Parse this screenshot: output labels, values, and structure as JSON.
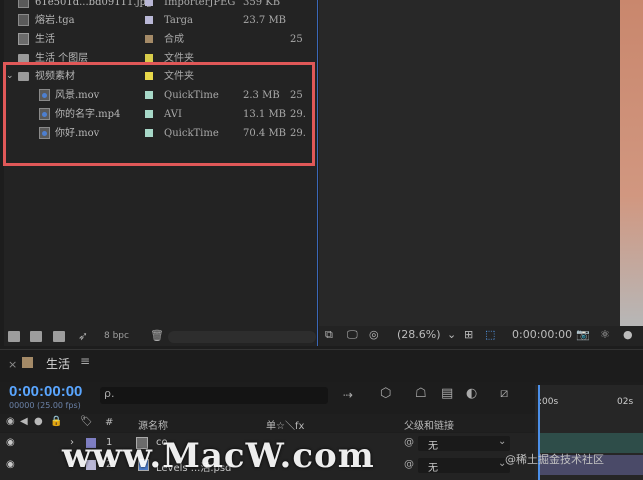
{
  "project_panel": {
    "rows": [
      {
        "name": "61e501d...bd09111.jpg",
        "type": "ImporterJPEG",
        "size": "359 KB",
        "fps": "",
        "tag_color": "#b9b7d6",
        "kind": "file"
      },
      {
        "name": "熔岩.tga",
        "type": "Targa",
        "size": "23.7 MB",
        "fps": "",
        "tag_color": "#b9b7d6",
        "kind": "file"
      },
      {
        "name": "生活",
        "type": "合成",
        "size": "",
        "fps": "25",
        "tag_color": "#a48a67",
        "kind": "comp"
      },
      {
        "name": "生活 个图层",
        "type": "文件夹",
        "size": "",
        "fps": "",
        "tag_color": "#d8cc4a",
        "kind": "folder"
      },
      {
        "name": "视频素材",
        "type": "文件夹",
        "size": "",
        "fps": "",
        "tag_color": "#e8d84a",
        "kind": "folder"
      },
      {
        "name": "风景.mov",
        "type": "QuickTime",
        "size": "2.3 MB",
        "fps": "25",
        "tag_color": "#a7d8c8",
        "kind": "file"
      },
      {
        "name": "你的名字.mp4",
        "type": "AVI",
        "size": "13.1 MB",
        "fps": "29.",
        "tag_color": "#a7d8c8",
        "kind": "file"
      },
      {
        "name": "你好.mov",
        "type": "QuickTime",
        "size": "70.4 MB",
        "fps": "29.",
        "tag_color": "#a7d8c8",
        "kind": "file"
      }
    ],
    "footer": {
      "bpc": "8 bpc"
    }
  },
  "viewer_toolbar": {
    "zoom": "(28.6%)",
    "timecode": "0:00:00:00"
  },
  "timeline": {
    "tab_close": "×",
    "tab_name": "生活",
    "menu_icon": "≡",
    "current_time": "0:00:00:00",
    "fps_label": "00000 (25.00 fps)",
    "search_placeholder": "ρ.",
    "columns": {
      "hash": "#",
      "source_name": "源名称",
      "switches": "单☆＼fx",
      "parent": "父级和链接"
    },
    "rows": [
      {
        "index": "1",
        "name": "co",
        "parent": "无",
        "label_color": "#7e7ec2"
      },
      {
        "index": "2",
        "name": "Levels ...活.psd",
        "parent": "无",
        "label_color": "#b9b7d6"
      }
    ],
    "ruler": {
      "start": ":00s",
      "end": "02s"
    }
  },
  "overlay": {
    "watermark": "www.MacW.com",
    "credit": "@稀土掘金技术社区"
  },
  "colors": {
    "accent": "#3a67b8",
    "highlight_box": "#e05858",
    "timecode": "#5aa6ff"
  }
}
